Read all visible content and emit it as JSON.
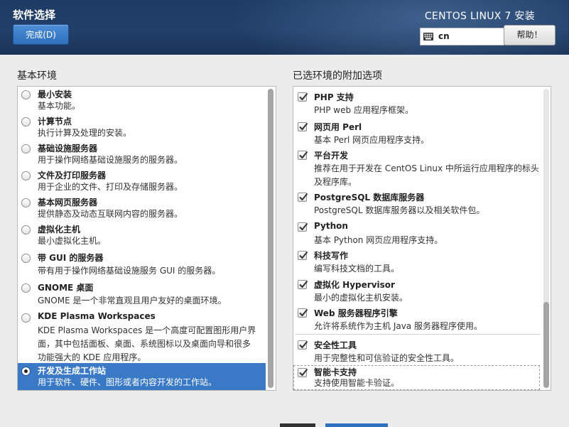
{
  "header": {
    "title": "软件选择",
    "done_label": "完成(D)",
    "install_title": "CENTOS LINUX 7 安装",
    "keyboard_layout": "cn",
    "help_label": "帮助！"
  },
  "base_env": {
    "heading": "基本环境",
    "selected_index": 9,
    "items": [
      {
        "name": "最小安装",
        "desc": "基本功能。"
      },
      {
        "name": "计算节点",
        "desc": "执行计算及处理的安装。"
      },
      {
        "name": "基础设施服务器",
        "desc": "用于操作网络基础设施服务的服务器。"
      },
      {
        "name": "文件及打印服务器",
        "desc": "用于企业的文件、打印及存储服务器。"
      },
      {
        "name": "基本网页服务器",
        "desc": "提供静态及动态互联网内容的服务器。"
      },
      {
        "name": "虚拟化主机",
        "desc": "最小虚拟化主机。"
      },
      {
        "name": "带 GUI 的服务器",
        "desc": "带有用于操作网络基础设施服务 GUI 的服务器。"
      },
      {
        "name": "GNOME 桌面",
        "desc": "GNOME 是一个非常直观且用户友好的桌面环境。"
      },
      {
        "name": "KDE Plasma Workspaces",
        "desc": "KDE Plasma Workspaces 是一个高度可配置图形用户界面，其中包括面板、桌面、系统图标以及桌面向导和很多功能强大的 KDE 应用程序。"
      },
      {
        "name": "开发及生成工作站",
        "desc": "用于软件、硬件、图形或者内容开发的工作站。"
      }
    ]
  },
  "addons": {
    "heading": "已选环境的附加选项",
    "items": [
      {
        "name": "PHP 支持",
        "desc": "PHP web 应用程序框架。",
        "checked": true
      },
      {
        "name": "网页用 Perl",
        "desc": "基本 Perl 网页应用程序支持。",
        "checked": true
      },
      {
        "name": "平台开发",
        "desc": "推荐在用于开发在 CentOS Linux 中所运行应用程序的标头及程序库。",
        "checked": true
      },
      {
        "name": "PostgreSQL 数据库服务器",
        "desc": "PostgreSQL 数据库服务器以及相关软件包。",
        "checked": true
      },
      {
        "name": "Python",
        "desc": "基本 Python 网页应用程序支持。",
        "checked": true
      },
      {
        "name": "科技写作",
        "desc": "编写科技文档的工具。",
        "checked": true
      },
      {
        "name": "虚拟化 Hypervisor",
        "desc": "最小的虚拟化主机安装。",
        "checked": true
      },
      {
        "name": "Web 服务器程序引擎",
        "desc": "允许将系统作为主机 Java 服务器程序使用。",
        "checked": true
      },
      {
        "name": "安全性工具",
        "desc": "用于完整性和可信验证的安全性工具。",
        "checked": true
      },
      {
        "name": "智能卡支持",
        "desc": "支持使用智能卡验证。",
        "checked": true
      }
    ]
  },
  "colors": {
    "header_bg": "#213f69",
    "accent": "#3a79c5"
  },
  "icons": {
    "keyboard": "keyboard-icon",
    "checkbox": "checkmark-icon",
    "radio": "radio-icon"
  }
}
